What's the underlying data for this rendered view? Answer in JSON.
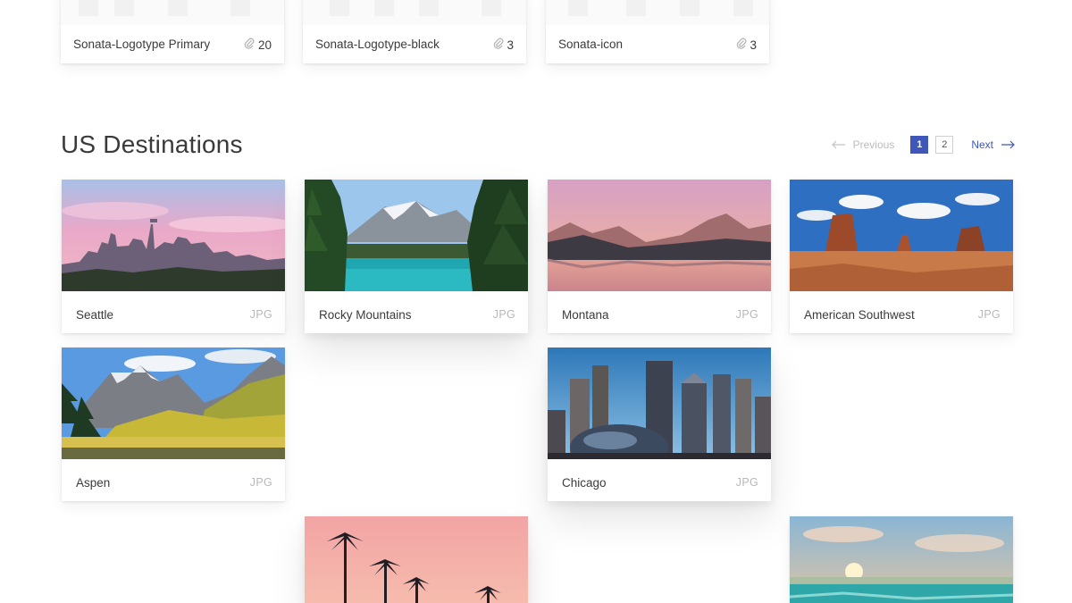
{
  "top_assets": [
    {
      "name": "Sonata-Logotype Primary",
      "count": "20"
    },
    {
      "name": "Sonata-Logotype-black",
      "count": "3"
    },
    {
      "name": "Sonata-icon",
      "count": "3"
    }
  ],
  "section": {
    "title": "US Destinations"
  },
  "pagination": {
    "previous": "Previous",
    "next": "Next",
    "pages": [
      "1",
      "2"
    ],
    "current": "1"
  },
  "assets": [
    {
      "name": "Seattle",
      "type": "JPG"
    },
    {
      "name": "Rocky Mountains",
      "type": "JPG"
    },
    {
      "name": "Montana",
      "type": "JPG"
    },
    {
      "name": "American Southwest",
      "type": "JPG"
    },
    {
      "name": "Aspen",
      "type": "JPG"
    },
    {
      "name": "Chicago",
      "type": "JPG"
    }
  ],
  "colors": {
    "accent": "#3f57b8",
    "page_bg": "#ffffff",
    "muted": "#b8b8b8"
  }
}
